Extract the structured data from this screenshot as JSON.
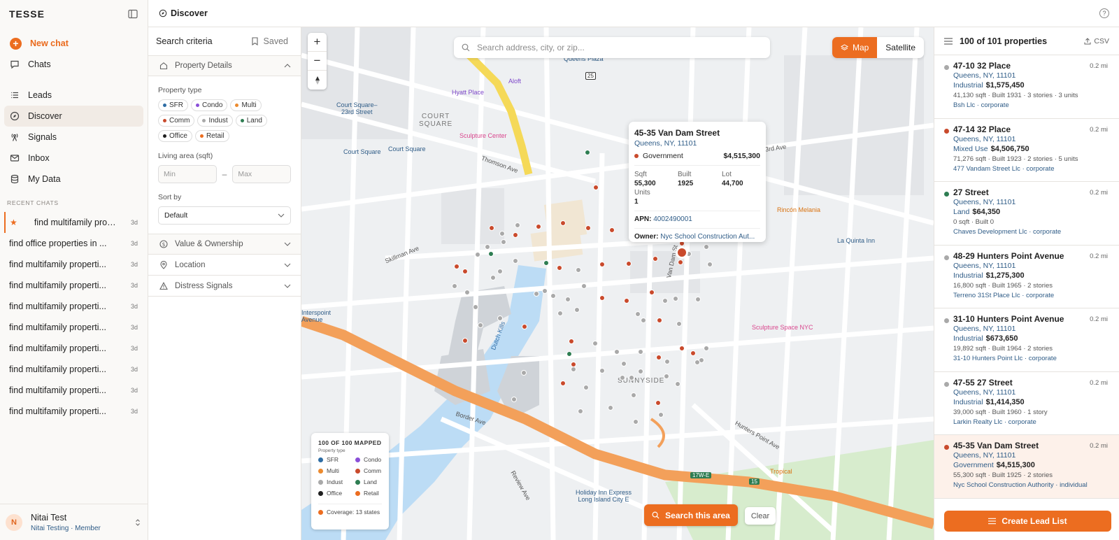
{
  "app": {
    "brand": "TESSE"
  },
  "nav": {
    "new_chat": "New chat",
    "chats": "Chats",
    "leads": "Leads",
    "discover": "Discover",
    "signals": "Signals",
    "inbox": "Inbox",
    "my_data": "My Data"
  },
  "recent": {
    "label": "RECENT CHATS",
    "items": [
      {
        "title": "find multifamily prop...",
        "age": "3d"
      },
      {
        "title": "find office properties in ...",
        "age": "3d"
      },
      {
        "title": "find multifamily properti...",
        "age": "3d"
      },
      {
        "title": "find multifamily properti...",
        "age": "3d"
      },
      {
        "title": "find multifamily properti...",
        "age": "3d"
      },
      {
        "title": "find multifamily properti...",
        "age": "3d"
      },
      {
        "title": "find multifamily properti...",
        "age": "3d"
      },
      {
        "title": "find multifamily properti...",
        "age": "3d"
      },
      {
        "title": "find multifamily properti...",
        "age": "3d"
      },
      {
        "title": "find multifamily properti...",
        "age": "3d"
      }
    ]
  },
  "user": {
    "initial": "N",
    "name": "Nitai Test",
    "org_role": "Nitai Testing · Member"
  },
  "topbar": {
    "title": "Discover",
    "help": "?"
  },
  "criteria": {
    "title": "Search criteria",
    "saved": "Saved",
    "property_details": "Property Details",
    "property_type_label": "Property type",
    "types": [
      {
        "label": "SFR",
        "color": "#2e6da4"
      },
      {
        "label": "Condo",
        "color": "#8a4fd8"
      },
      {
        "label": "Multi",
        "color": "#ec8a2e"
      },
      {
        "label": "Comm",
        "color": "#c94a2c"
      },
      {
        "label": "Indust",
        "color": "#a9a9a9"
      },
      {
        "label": "Land",
        "color": "#2e7d52"
      },
      {
        "label": "Office",
        "color": "#1f1f1f"
      },
      {
        "label": "Retail",
        "color": "#ec6d20"
      }
    ],
    "living_area_label": "Living area (sqft)",
    "min_placeholder": "Min",
    "max_placeholder": "Max",
    "range_sep": "–",
    "sort_label": "Sort by",
    "sort_value": "Default",
    "value_ownership": "Value & Ownership",
    "location": "Location",
    "distress": "Distress Signals"
  },
  "map": {
    "search_placeholder": "Search address, city, or zip...",
    "toggle_map": "Map",
    "toggle_satellite": "Satellite",
    "labels": {
      "queens_plaza": "Queens Plaza",
      "hyatt": "Hyatt Place",
      "aloft": "Aloft",
      "court_square_23rd": "Court Square–\n23rd Street",
      "court_square_area": "COURT\nSQUARE",
      "court_square_1": "Court Square",
      "court_square_2": "Court Square",
      "sculpture_center": "Sculpture Center",
      "thomson": "Thomson Ave",
      "fortythird": "43rd Ave",
      "rincon": "Rincón Melania",
      "la_quinta": "La Quinta Inn",
      "sculpture_space": "Sculpture Space NYC",
      "sunnyside": "SUNNYSIDE",
      "border": "Border Ave",
      "skillman": "Skillman Ave",
      "interspoint": "Interspoint\nAvenue",
      "dutch_kills": "Dutch Kills",
      "hunters_point": "Hunters Point Ave",
      "holiday_inn": "Holiday Inn Express\nLong Island City E",
      "tropical": "Tropical",
      "review": "Review Ave",
      "vandam": "Van Dam St",
      "route_17w": "17W-E",
      "route_15": "15",
      "route_25": "25"
    },
    "popup": {
      "title": "45-35 Van Dam Street",
      "city": "Queens, NY, 11101",
      "type": "Government",
      "value": "$4,515,300",
      "sqft_label": "Sqft",
      "sqft": "55,300",
      "built_label": "Built",
      "built": "1925",
      "lot_label": "Lot",
      "lot": "44,700",
      "units_label": "Units",
      "units": "1",
      "apn_label": "APN:",
      "apn": "4002490001",
      "owner_label": "Owner:",
      "owner": "Nyc School Construction Aut..."
    },
    "legend": {
      "head": "100 OF 100 MAPPED",
      "sub": "Property type",
      "items": [
        {
          "label": "SFR",
          "color": "#2e6da4"
        },
        {
          "label": "Condo",
          "color": "#8a4fd8"
        },
        {
          "label": "Multi",
          "color": "#ec8a2e"
        },
        {
          "label": "Comm",
          "color": "#c94a2c"
        },
        {
          "label": "Indust",
          "color": "#a9a9a9"
        },
        {
          "label": "Land",
          "color": "#2e7d52"
        },
        {
          "label": "Office",
          "color": "#1f1f1f"
        },
        {
          "label": "Retail",
          "color": "#ec6d20"
        }
      ],
      "coverage": "Coverage: 13 states"
    },
    "search_area": "Search this area",
    "clear": "Clear"
  },
  "results": {
    "count": "100 of 101 properties",
    "csv": "CSV",
    "cards": [
      {
        "addr": "47-10 32 Place",
        "city": "Queens, NY, 11101",
        "type": "Industrial",
        "value": "$1,575,450",
        "meta": "41,130 sqft  ·  Built 1931  ·  3 stories  ·  3 units",
        "owner": "Bsh Llc · corporate",
        "dist": "0.2 mi",
        "color": "#a9a9a9"
      },
      {
        "addr": "47-14 32 Place",
        "city": "Queens, NY, 11101",
        "type": "Mixed Use",
        "value": "$4,506,750",
        "meta": "71,276 sqft  ·  Built 1923  ·  2 stories  ·  5 units",
        "owner": "477 Vandam Street Llc · corporate",
        "dist": "0.2 mi",
        "color": "#c94a2c"
      },
      {
        "addr": "27 Street",
        "city": "Queens, NY, 11101",
        "type": "Land",
        "value": "$64,350",
        "meta": "0 sqft  ·  Built 0",
        "owner": "Chaves Development Llc · corporate",
        "dist": "0.2 mi",
        "color": "#2e7d52"
      },
      {
        "addr": "48-29 Hunters Point Avenue",
        "city": "Queens, NY, 11101",
        "type": "Industrial",
        "value": "$1,275,300",
        "meta": "16,800 sqft  ·  Built 1965  ·  2 stories",
        "owner": "Terreno 31St Place Llc · corporate",
        "dist": "0.2 mi",
        "color": "#a9a9a9"
      },
      {
        "addr": "31-10 Hunters Point Avenue",
        "city": "Queens, NY, 11101",
        "type": "Industrial",
        "value": "$673,650",
        "meta": "19,892 sqft  ·  Built 1964  ·  2 stories",
        "owner": "31-10 Hunters Point Llc · corporate",
        "dist": "0.2 mi",
        "color": "#a9a9a9"
      },
      {
        "addr": "47-55 27 Street",
        "city": "Queens, NY, 11101",
        "type": "Industrial",
        "value": "$1,414,350",
        "meta": "39,000 sqft  ·  Built 1960  ·  1 story",
        "owner": "Larkin Realty Llc · corporate",
        "dist": "0.2 mi",
        "color": "#a9a9a9"
      },
      {
        "addr": "45-35 Van Dam Street",
        "city": "Queens, NY, 11101",
        "type": "Government",
        "value": "$4,515,300",
        "meta": "55,300 sqft  ·  Built 1925  ·  2 stories",
        "owner": "Nyc School Construction Authority · individual",
        "dist": "0.2 mi",
        "color": "#c94a2c"
      }
    ],
    "create": "Create Lead List"
  }
}
